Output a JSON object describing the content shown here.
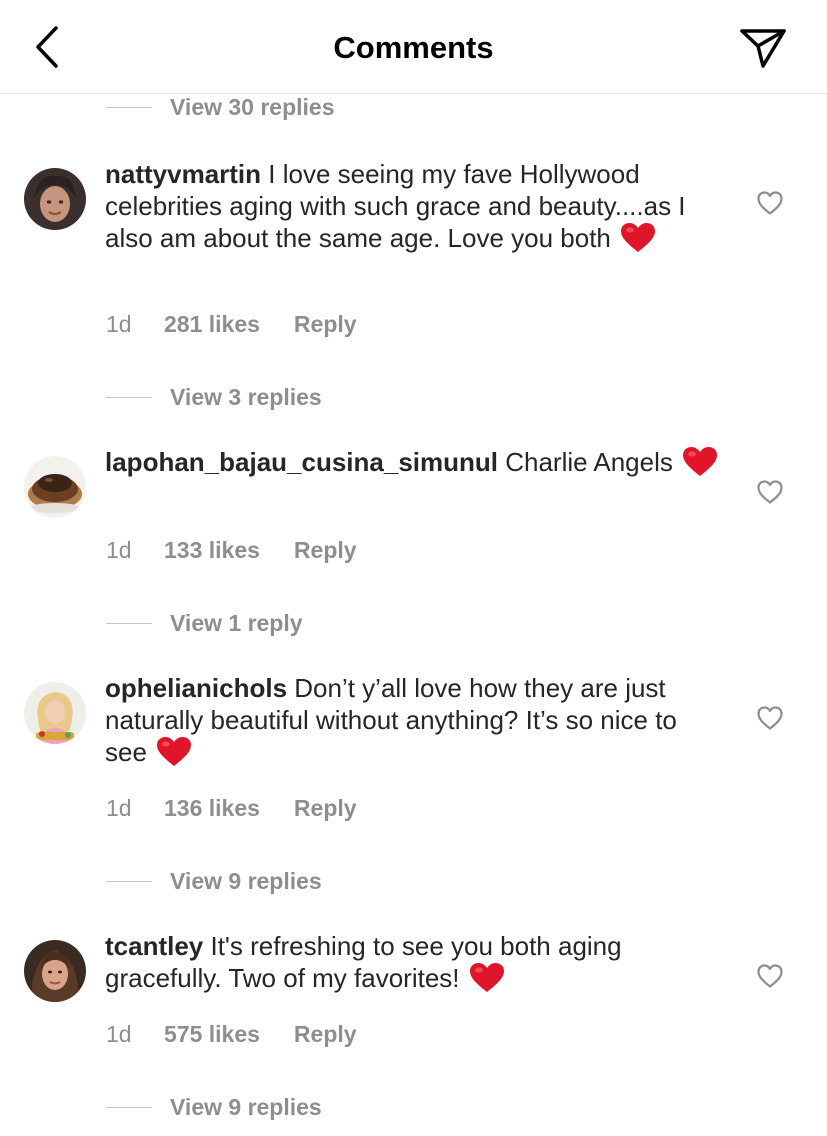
{
  "header": {
    "title": "Comments",
    "back_icon": "chevron-left-icon",
    "share_icon": "paper-plane-icon"
  },
  "top_replies": {
    "label": "View 30 replies"
  },
  "comments": [
    {
      "username": "nattyvmartin",
      "text": " I love seeing my fave Hollywood celebrities aging with such grace and beauty....as I also am about the same age. Love you both ",
      "emoji": "red-heart",
      "time": "1d",
      "likes": "281 likes",
      "reply": "Reply",
      "view_replies": "View 3 replies"
    },
    {
      "username": "lapohan_bajau_cusina_simunul",
      "text": " Charlie Angels ",
      "emoji": "red-heart",
      "time": "1d",
      "likes": "133 likes",
      "reply": "Reply",
      "view_replies": "View 1 reply"
    },
    {
      "username": "ophelianichols",
      "text": " Don’t y’all love how they are just naturally beautiful without anything? It’s so nice to see ",
      "emoji": "red-heart",
      "time": "1d",
      "likes": "136 likes",
      "reply": "Reply",
      "view_replies": "View 9 replies"
    },
    {
      "username": "tcantley",
      "text": " It's refreshing to see you both aging gracefully. Two of my favorites! ",
      "emoji": "red-heart",
      "time": "1d",
      "likes": "575 likes",
      "reply": "Reply",
      "view_replies": "View 9 replies"
    }
  ],
  "colors": {
    "text": "#262626",
    "secondary": "#8e8e8e",
    "heart": "#e0152a",
    "divider": "#e3e3e3"
  }
}
